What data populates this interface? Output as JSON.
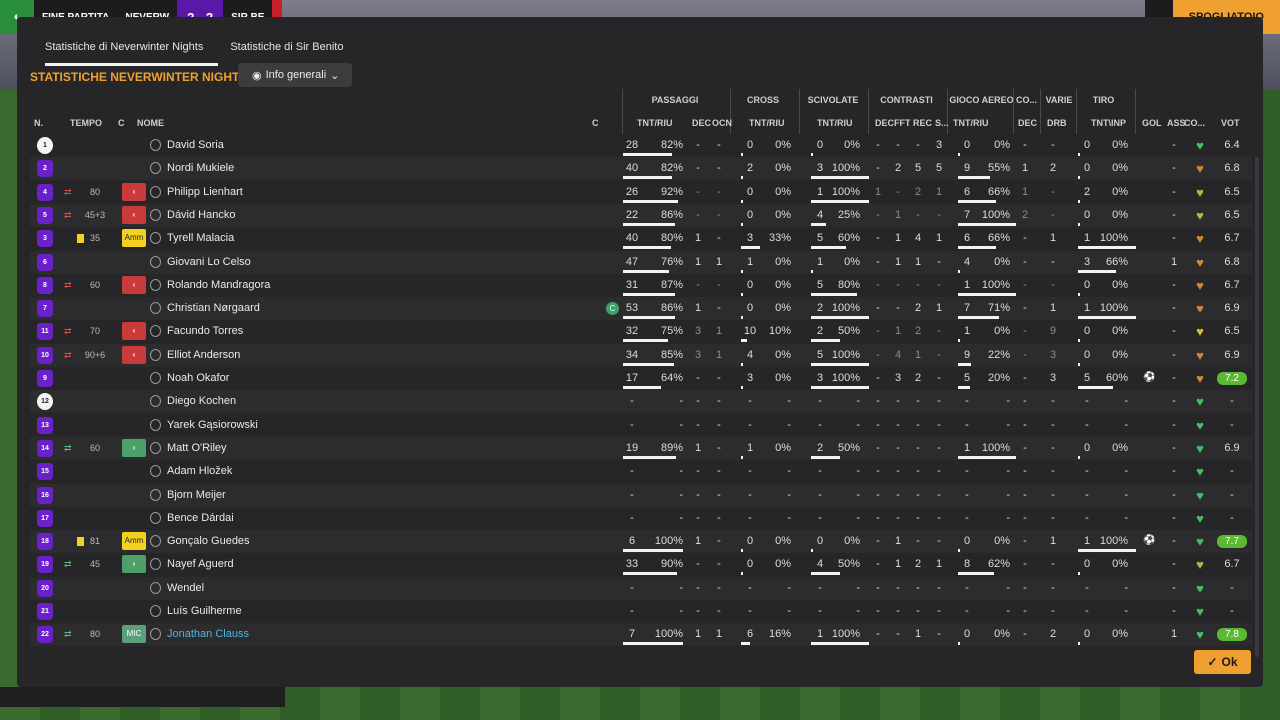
{
  "topbar": {
    "label": "FINE PARTITA",
    "home": "NEVERW",
    "score": "2 - 2",
    "away": "SIR BE",
    "button": "SPOGLIATOIO"
  },
  "tabs": [
    "Statistiche di Neverwinter Nights",
    "Statistiche di Sir Benito"
  ],
  "section_title": "STATISTICHE NEVERWINTER NIGHTS",
  "dropdown": "Info generali",
  "groups": [
    "PASSAGGI",
    "CROSS",
    "SCIVOLATE",
    "CONTRASTI",
    "GIOCO AEREO",
    "CO...",
    "VARIE",
    "TIRO"
  ],
  "headers": [
    "N.",
    "TEMPO",
    "C",
    "NOME",
    "C",
    "TNT/RIU",
    "DEC",
    "OCN",
    "TNT/RIU",
    "TNT/RIU",
    "DEC",
    "FFT",
    "REC",
    "S...",
    "TNT/RIU",
    "DEC",
    "DRB",
    "TNT\\INP",
    "GOL",
    "ASS",
    "CO...",
    "VOT"
  ],
  "ok_label": "Ok",
  "colors": {
    "accent": "#f0a030",
    "purple": "#6a21c9",
    "sub_out": "#c93a3a",
    "sub_in": "#4ea06a",
    "card": "#f2d21e"
  },
  "players": [
    {
      "n": "1",
      "gk": true,
      "name": "David Soria",
      "st": "active",
      "pass": [
        "28",
        "82%"
      ],
      "dec": "-",
      "ocn": "-",
      "cross": [
        "0",
        "0%"
      ],
      "tack": [
        "0",
        "0%"
      ],
      "cdec": "-",
      "fft": "-",
      "rec": "-",
      "s": "3",
      "air": [
        "0",
        "0%"
      ],
      "codec": "-",
      "drb": "-",
      "shot": [
        "0",
        "0%"
      ],
      "gol": "",
      "ass": "-",
      "heart": "green",
      "vote": "6.4"
    },
    {
      "n": "2",
      "name": "Nordi Mukiele",
      "st": "active",
      "pass": [
        "40",
        "82%"
      ],
      "dec": "-",
      "ocn": "-",
      "cross": [
        "2",
        "0%"
      ],
      "tack": [
        "3",
        "100%"
      ],
      "cdec": "-",
      "fft": "2",
      "rec": "5",
      "s": "5",
      "air": [
        "9",
        "55%"
      ],
      "codec": "1",
      "drb": "2",
      "shot": [
        "0",
        "0%"
      ],
      "gol": "",
      "ass": "-",
      "heart": "orange",
      "vote": "6.8"
    },
    {
      "n": "4",
      "name": "Philipp Lienhart",
      "st": "out",
      "min": "80",
      "badge": "red",
      "pass": [
        "26",
        "92%"
      ],
      "dec": "-",
      "ocn": "-",
      "cross": [
        "0",
        "0%"
      ],
      "tack": [
        "1",
        "100%"
      ],
      "cdec": "1",
      "fft": "-",
      "rec": "2",
      "s": "1",
      "air": [
        "6",
        "66%"
      ],
      "codec": "1",
      "drb": "-",
      "shot": [
        "2",
        "0%"
      ],
      "gol": "",
      "ass": "-",
      "heart": "yellowgreen",
      "vote": "6.5"
    },
    {
      "n": "5",
      "name": "Dávid Hancko",
      "st": "out",
      "min": "45+3",
      "badge": "red",
      "pass": [
        "22",
        "86%"
      ],
      "dec": "-",
      "ocn": "-",
      "cross": [
        "0",
        "0%"
      ],
      "tack": [
        "4",
        "25%"
      ],
      "cdec": "-",
      "fft": "1",
      "rec": "-",
      "s": "-",
      "air": [
        "7",
        "100%"
      ],
      "codec": "2",
      "drb": "-",
      "shot": [
        "0",
        "0%"
      ],
      "gol": "",
      "ass": "-",
      "heart": "yellowgreen",
      "vote": "6.5"
    },
    {
      "n": "3",
      "name": "Tyrell Malacia",
      "st": "card",
      "min": "35",
      "badge": "amm",
      "pass": [
        "40",
        "80%"
      ],
      "dec": "1",
      "ocn": "-",
      "cross": [
        "3",
        "33%"
      ],
      "tack": [
        "5",
        "60%"
      ],
      "cdec": "-",
      "fft": "1",
      "rec": "4",
      "s": "1",
      "air": [
        "6",
        "66%"
      ],
      "codec": "-",
      "drb": "1",
      "shot": [
        "1",
        "100%"
      ],
      "gol": "",
      "ass": "-",
      "heart": "orange",
      "vote": "6.7"
    },
    {
      "n": "6",
      "name": "Giovani Lo Celso",
      "st": "active",
      "pass": [
        "47",
        "76%"
      ],
      "dec": "1",
      "ocn": "1",
      "cross": [
        "1",
        "0%"
      ],
      "tack": [
        "1",
        "0%"
      ],
      "cdec": "-",
      "fft": "1",
      "rec": "1",
      "s": "-",
      "air": [
        "4",
        "0%"
      ],
      "codec": "-",
      "drb": "-",
      "shot": [
        "3",
        "66%"
      ],
      "gol": "",
      "ass": "1",
      "heart": "orange",
      "vote": "6.8"
    },
    {
      "n": "8",
      "name": "Rolando Mandragora",
      "st": "out",
      "min": "60",
      "badge": "red",
      "pass": [
        "31",
        "87%"
      ],
      "dec": "-",
      "ocn": "-",
      "cross": [
        "0",
        "0%"
      ],
      "tack": [
        "5",
        "80%"
      ],
      "cdec": "-",
      "fft": "-",
      "rec": "-",
      "s": "-",
      "air": [
        "1",
        "100%"
      ],
      "codec": "-",
      "drb": "-",
      "shot": [
        "0",
        "0%"
      ],
      "gol": "",
      "ass": "-",
      "heart": "orange",
      "vote": "6.7"
    },
    {
      "n": "7",
      "name": "Christian Nørgaard",
      "st": "active",
      "capt": true,
      "pass": [
        "53",
        "86%"
      ],
      "dec": "1",
      "ocn": "-",
      "cross": [
        "0",
        "0%"
      ],
      "tack": [
        "2",
        "100%"
      ],
      "cdec": "-",
      "fft": "-",
      "rec": "2",
      "s": "1",
      "air": [
        "7",
        "71%"
      ],
      "codec": "-",
      "drb": "1",
      "shot": [
        "1",
        "100%"
      ],
      "gol": "",
      "ass": "-",
      "heart": "orange",
      "vote": "6.9"
    },
    {
      "n": "11",
      "name": "Facundo Torres",
      "st": "out",
      "min": "70",
      "badge": "red",
      "pass": [
        "32",
        "75%"
      ],
      "dec": "3",
      "ocn": "1",
      "cross": [
        "10",
        "10%"
      ],
      "tack": [
        "2",
        "50%"
      ],
      "cdec": "-",
      "fft": "1",
      "rec": "2",
      "s": "-",
      "air": [
        "1",
        "0%"
      ],
      "codec": "-",
      "drb": "9",
      "shot": [
        "0",
        "0%"
      ],
      "gol": "",
      "ass": "-",
      "heart": "yellow",
      "vote": "6.5"
    },
    {
      "n": "10",
      "name": "Elliot Anderson",
      "st": "out",
      "min": "90+6",
      "badge": "red",
      "pass": [
        "34",
        "85%"
      ],
      "dec": "3",
      "ocn": "1",
      "cross": [
        "4",
        "0%"
      ],
      "tack": [
        "5",
        "100%"
      ],
      "cdec": "-",
      "fft": "4",
      "rec": "1",
      "s": "-",
      "air": [
        "9",
        "22%"
      ],
      "codec": "-",
      "drb": "3",
      "shot": [
        "0",
        "0%"
      ],
      "gol": "",
      "ass": "-",
      "heart": "orange",
      "vote": "6.9"
    },
    {
      "n": "9",
      "name": "Noah Okafor",
      "st": "active",
      "pass": [
        "17",
        "64%"
      ],
      "dec": "-",
      "ocn": "-",
      "cross": [
        "3",
        "0%"
      ],
      "tack": [
        "3",
        "100%"
      ],
      "cdec": "-",
      "fft": "3",
      "rec": "2",
      "s": "-",
      "air": [
        "5",
        "20%"
      ],
      "codec": "-",
      "drb": "3",
      "shot": [
        "5",
        "60%"
      ],
      "gol": "ball",
      "ass": "-",
      "heart": "orange",
      "vote": "7.2",
      "vhi": true
    },
    {
      "n": "12",
      "gk": true,
      "name": "Diego Kochen",
      "st": "bench",
      "pass": [
        "-",
        "-"
      ],
      "dec": "-",
      "ocn": "-",
      "cross": [
        "-",
        "-"
      ],
      "tack": [
        "-",
        "-"
      ],
      "cdec": "-",
      "fft": "-",
      "rec": "-",
      "s": "-",
      "air": [
        "-",
        "-"
      ],
      "codec": "-",
      "drb": "-",
      "shot": [
        "-",
        "-"
      ],
      "gol": "",
      "ass": "-",
      "heart": "green",
      "vote": "-"
    },
    {
      "n": "13",
      "name": "Yarek Gąsiorowski",
      "st": "bench",
      "pass": [
        "-",
        "-"
      ],
      "dec": "-",
      "ocn": "-",
      "cross": [
        "-",
        "-"
      ],
      "tack": [
        "-",
        "-"
      ],
      "cdec": "-",
      "fft": "-",
      "rec": "-",
      "s": "-",
      "air": [
        "-",
        "-"
      ],
      "codec": "-",
      "drb": "-",
      "shot": [
        "-",
        "-"
      ],
      "gol": "",
      "ass": "-",
      "heart": "green",
      "vote": "-"
    },
    {
      "n": "14",
      "name": "Matt O'Riley",
      "st": "in",
      "min": "60",
      "badge": "green",
      "pass": [
        "19",
        "89%"
      ],
      "dec": "1",
      "ocn": "-",
      "cross": [
        "1",
        "0%"
      ],
      "tack": [
        "2",
        "50%"
      ],
      "cdec": "-",
      "fft": "-",
      "rec": "-",
      "s": "-",
      "air": [
        "1",
        "100%"
      ],
      "codec": "-",
      "drb": "-",
      "shot": [
        "0",
        "0%"
      ],
      "gol": "",
      "ass": "-",
      "heart": "green",
      "vote": "6.9"
    },
    {
      "n": "15",
      "name": "Adam Hložek",
      "st": "bench",
      "pass": [
        "-",
        "-"
      ],
      "dec": "-",
      "ocn": "-",
      "cross": [
        "-",
        "-"
      ],
      "tack": [
        "-",
        "-"
      ],
      "cdec": "-",
      "fft": "-",
      "rec": "-",
      "s": "-",
      "air": [
        "-",
        "-"
      ],
      "codec": "-",
      "drb": "-",
      "shot": [
        "-",
        "-"
      ],
      "gol": "",
      "ass": "-",
      "heart": "green",
      "vote": "-"
    },
    {
      "n": "16",
      "name": "Bjorn Meijer",
      "st": "bench",
      "pass": [
        "-",
        "-"
      ],
      "dec": "-",
      "ocn": "-",
      "cross": [
        "-",
        "-"
      ],
      "tack": [
        "-",
        "-"
      ],
      "cdec": "-",
      "fft": "-",
      "rec": "-",
      "s": "-",
      "air": [
        "-",
        "-"
      ],
      "codec": "-",
      "drb": "-",
      "shot": [
        "-",
        "-"
      ],
      "gol": "",
      "ass": "-",
      "heart": "green",
      "vote": "-"
    },
    {
      "n": "17",
      "name": "Bence Dárdai",
      "st": "bench",
      "pass": [
        "-",
        "-"
      ],
      "dec": "-",
      "ocn": "-",
      "cross": [
        "-",
        "-"
      ],
      "tack": [
        "-",
        "-"
      ],
      "cdec": "-",
      "fft": "-",
      "rec": "-",
      "s": "-",
      "air": [
        "-",
        "-"
      ],
      "codec": "-",
      "drb": "-",
      "shot": [
        "-",
        "-"
      ],
      "gol": "",
      "ass": "-",
      "heart": "green",
      "vote": "-"
    },
    {
      "n": "18",
      "name": "Gonçalo Guedes",
      "st": "card",
      "min": "81",
      "badge": "amm",
      "pass": [
        "6",
        "100%"
      ],
      "dec": "1",
      "ocn": "-",
      "cross": [
        "0",
        "0%"
      ],
      "tack": [
        "0",
        "0%"
      ],
      "cdec": "-",
      "fft": "1",
      "rec": "-",
      "s": "-",
      "air": [
        "0",
        "0%"
      ],
      "codec": "-",
      "drb": "1",
      "shot": [
        "1",
        "100%"
      ],
      "gol": "ball",
      "ass": "-",
      "heart": "green",
      "vote": "7.7",
      "vhi": true
    },
    {
      "n": "19",
      "name": "Nayef Aguerd",
      "st": "in",
      "min": "45",
      "badge": "green",
      "pass": [
        "33",
        "90%"
      ],
      "dec": "-",
      "ocn": "-",
      "cross": [
        "0",
        "0%"
      ],
      "tack": [
        "4",
        "50%"
      ],
      "cdec": "-",
      "fft": "1",
      "rec": "2",
      "s": "1",
      "air": [
        "8",
        "62%"
      ],
      "codec": "-",
      "drb": "-",
      "shot": [
        "0",
        "0%"
      ],
      "gol": "",
      "ass": "-",
      "heart": "yellowgreen",
      "vote": "6.7"
    },
    {
      "n": "20",
      "name": "Wendel",
      "st": "bench",
      "pass": [
        "-",
        "-"
      ],
      "dec": "-",
      "ocn": "-",
      "cross": [
        "-",
        "-"
      ],
      "tack": [
        "-",
        "-"
      ],
      "cdec": "-",
      "fft": "-",
      "rec": "-",
      "s": "-",
      "air": [
        "-",
        "-"
      ],
      "codec": "-",
      "drb": "-",
      "shot": [
        "-",
        "-"
      ],
      "gol": "",
      "ass": "-",
      "heart": "green",
      "vote": "-"
    },
    {
      "n": "21",
      "name": "Luís Guilherme",
      "st": "bench",
      "pass": [
        "-",
        "-"
      ],
      "dec": "-",
      "ocn": "-",
      "cross": [
        "-",
        "-"
      ],
      "tack": [
        "-",
        "-"
      ],
      "cdec": "-",
      "fft": "-",
      "rec": "-",
      "s": "-",
      "air": [
        "-",
        "-"
      ],
      "codec": "-",
      "drb": "-",
      "shot": [
        "-",
        "-"
      ],
      "gol": "",
      "ass": "-",
      "heart": "green",
      "vote": "-"
    },
    {
      "n": "22",
      "name": "Jonathan Clauss",
      "st": "in",
      "min": "80",
      "badge": "mic",
      "hl": true,
      "pass": [
        "7",
        "100%"
      ],
      "dec": "1",
      "ocn": "1",
      "cross": [
        "6",
        "16%"
      ],
      "tack": [
        "1",
        "100%"
      ],
      "cdec": "-",
      "fft": "-",
      "rec": "1",
      "s": "-",
      "air": [
        "0",
        "0%"
      ],
      "codec": "-",
      "drb": "2",
      "shot": [
        "0",
        "0%"
      ],
      "gol": "",
      "ass": "1",
      "heart": "green",
      "vote": "7.8",
      "vhi": true
    }
  ]
}
